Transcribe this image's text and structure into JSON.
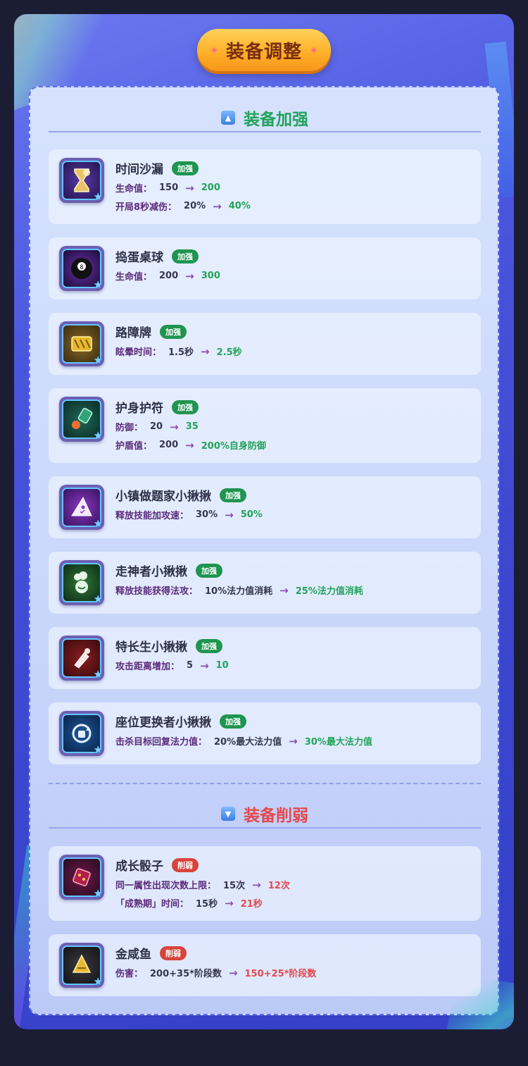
{
  "header": {
    "title": "装备调整"
  },
  "sections": {
    "buff": {
      "title": "装备加强"
    },
    "nerf": {
      "title": "装备削弱"
    }
  },
  "colors": {
    "buff": "#22a35a",
    "nerf": "#e5484d",
    "accent": "#ffb12a"
  },
  "buff_items": [
    {
      "name": "时间沙漏",
      "icon": "hourglass-icon",
      "badge": "加强",
      "stats": [
        {
          "label": "生命值：",
          "old": "150",
          "new": "200"
        },
        {
          "label": "开局8秒减伤：",
          "old": "20%",
          "new": "40%"
        }
      ]
    },
    {
      "name": "捣蛋桌球",
      "icon": "eight-ball-icon",
      "badge": "加强",
      "stats": [
        {
          "label": "生命值：",
          "old": "200",
          "new": "300"
        }
      ]
    },
    {
      "name": "路障牌",
      "icon": "roadblock-icon",
      "badge": "加强",
      "stats": [
        {
          "label": "眩晕时间：",
          "old": "1.5秒",
          "new": "2.5秒"
        }
      ]
    },
    {
      "name": "护身护符",
      "icon": "amulet-icon",
      "badge": "加强",
      "stats": [
        {
          "label": "防御：",
          "old": "20",
          "new": "35"
        },
        {
          "label": "护盾值：",
          "old": "200",
          "new": "200%自身防御"
        }
      ]
    },
    {
      "name": "小镇做题家小揪揪",
      "icon": "wizard-hat-icon",
      "badge": "加强",
      "stats": [
        {
          "label": "释放技能加攻速：",
          "old": "30%",
          "new": "50%"
        }
      ]
    },
    {
      "name": "走神者小揪揪",
      "icon": "thought-cloud-icon",
      "badge": "加强",
      "stats": [
        {
          "label": "释放技能获得法攻：",
          "old": "10%法力值消耗",
          "new": "25%法力值消耗"
        }
      ]
    },
    {
      "name": "特长生小揪揪",
      "icon": "brush-icon",
      "badge": "加强",
      "stats": [
        {
          "label": "攻击距离增加：",
          "old": "5",
          "new": "10"
        }
      ]
    },
    {
      "name": "座位更换者小揪揪",
      "icon": "seat-swap-icon",
      "badge": "加强",
      "stats": [
        {
          "label": "击杀目标回复法力值：",
          "old": "20%最大法力值",
          "new": "30%最大法力值"
        }
      ]
    }
  ],
  "nerf_items": [
    {
      "name": "成长骰子",
      "icon": "dice-icon",
      "badge": "削弱",
      "stats": [
        {
          "label": "同一属性出现次数上限：",
          "old": "15次",
          "new": "12次"
        },
        {
          "label": "「成熟期」时间：",
          "old": "15秒",
          "new": "21秒"
        }
      ]
    },
    {
      "name": "金咸鱼",
      "icon": "golden-fish-icon",
      "badge": "削弱",
      "stats": [
        {
          "label": "伤害：",
          "old": "200+35*阶段数",
          "new": "150+25*阶段数"
        }
      ]
    }
  ],
  "arrow": "→"
}
